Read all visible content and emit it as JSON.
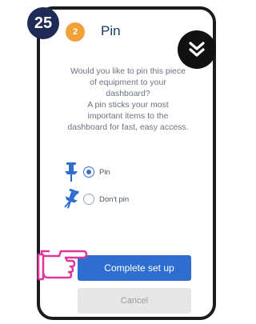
{
  "step_badge": "25",
  "header": {
    "step_number": "2",
    "title": "Pin"
  },
  "question": {
    "lines": [
      "Would you like to pin this piece",
      "of equipment to your",
      "dashboard?",
      "A pin sticks your most",
      "important items to the",
      "dashboard for fast, easy access."
    ]
  },
  "options": [
    {
      "label": "Pin",
      "selected": true,
      "icon": "pin-icon"
    },
    {
      "label": "Don't pin",
      "selected": false,
      "icon": "pin-crossed-icon"
    }
  ],
  "buttons": {
    "complete": "Complete set up",
    "cancel": "Cancel"
  },
  "colors": {
    "accent": "#2f6ed1",
    "badge": "#1f2b57",
    "step": "#f2a03a",
    "highlight": "#e0369a"
  },
  "icons": {
    "collapse": "double-chevron-down-icon",
    "pointer": "pointing-hand-icon"
  }
}
